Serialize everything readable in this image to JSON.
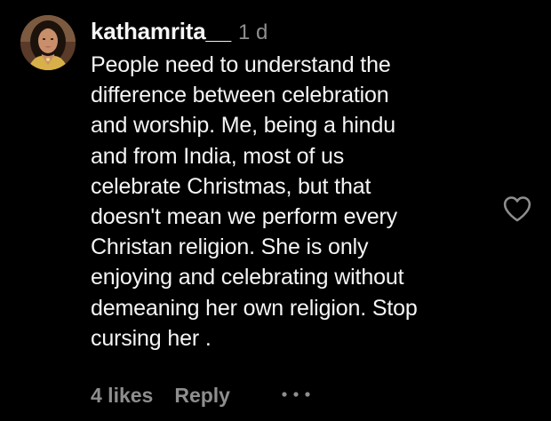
{
  "comment": {
    "username": "kathamrita__",
    "time": "1 d",
    "text_lines": [
      "People need to understand the",
      "difference between celebration",
      "and worship. Me, being a hindu",
      "and from India, most of us",
      "celebrate Christmas, but that",
      "doesn't mean we perform every",
      "Christan religion. She is only",
      "enjoying and celebrating without",
      "demeaning her own religion. Stop",
      "cursing her ."
    ],
    "likes_label": "4 likes",
    "reply_label": "Reply"
  },
  "icons": {
    "like": "heart-outline-icon",
    "more": "more-horizontal-icon"
  },
  "colors": {
    "background": "#000000",
    "primary_text": "#f5f5f5",
    "secondary_text": "#8e8e8e"
  }
}
